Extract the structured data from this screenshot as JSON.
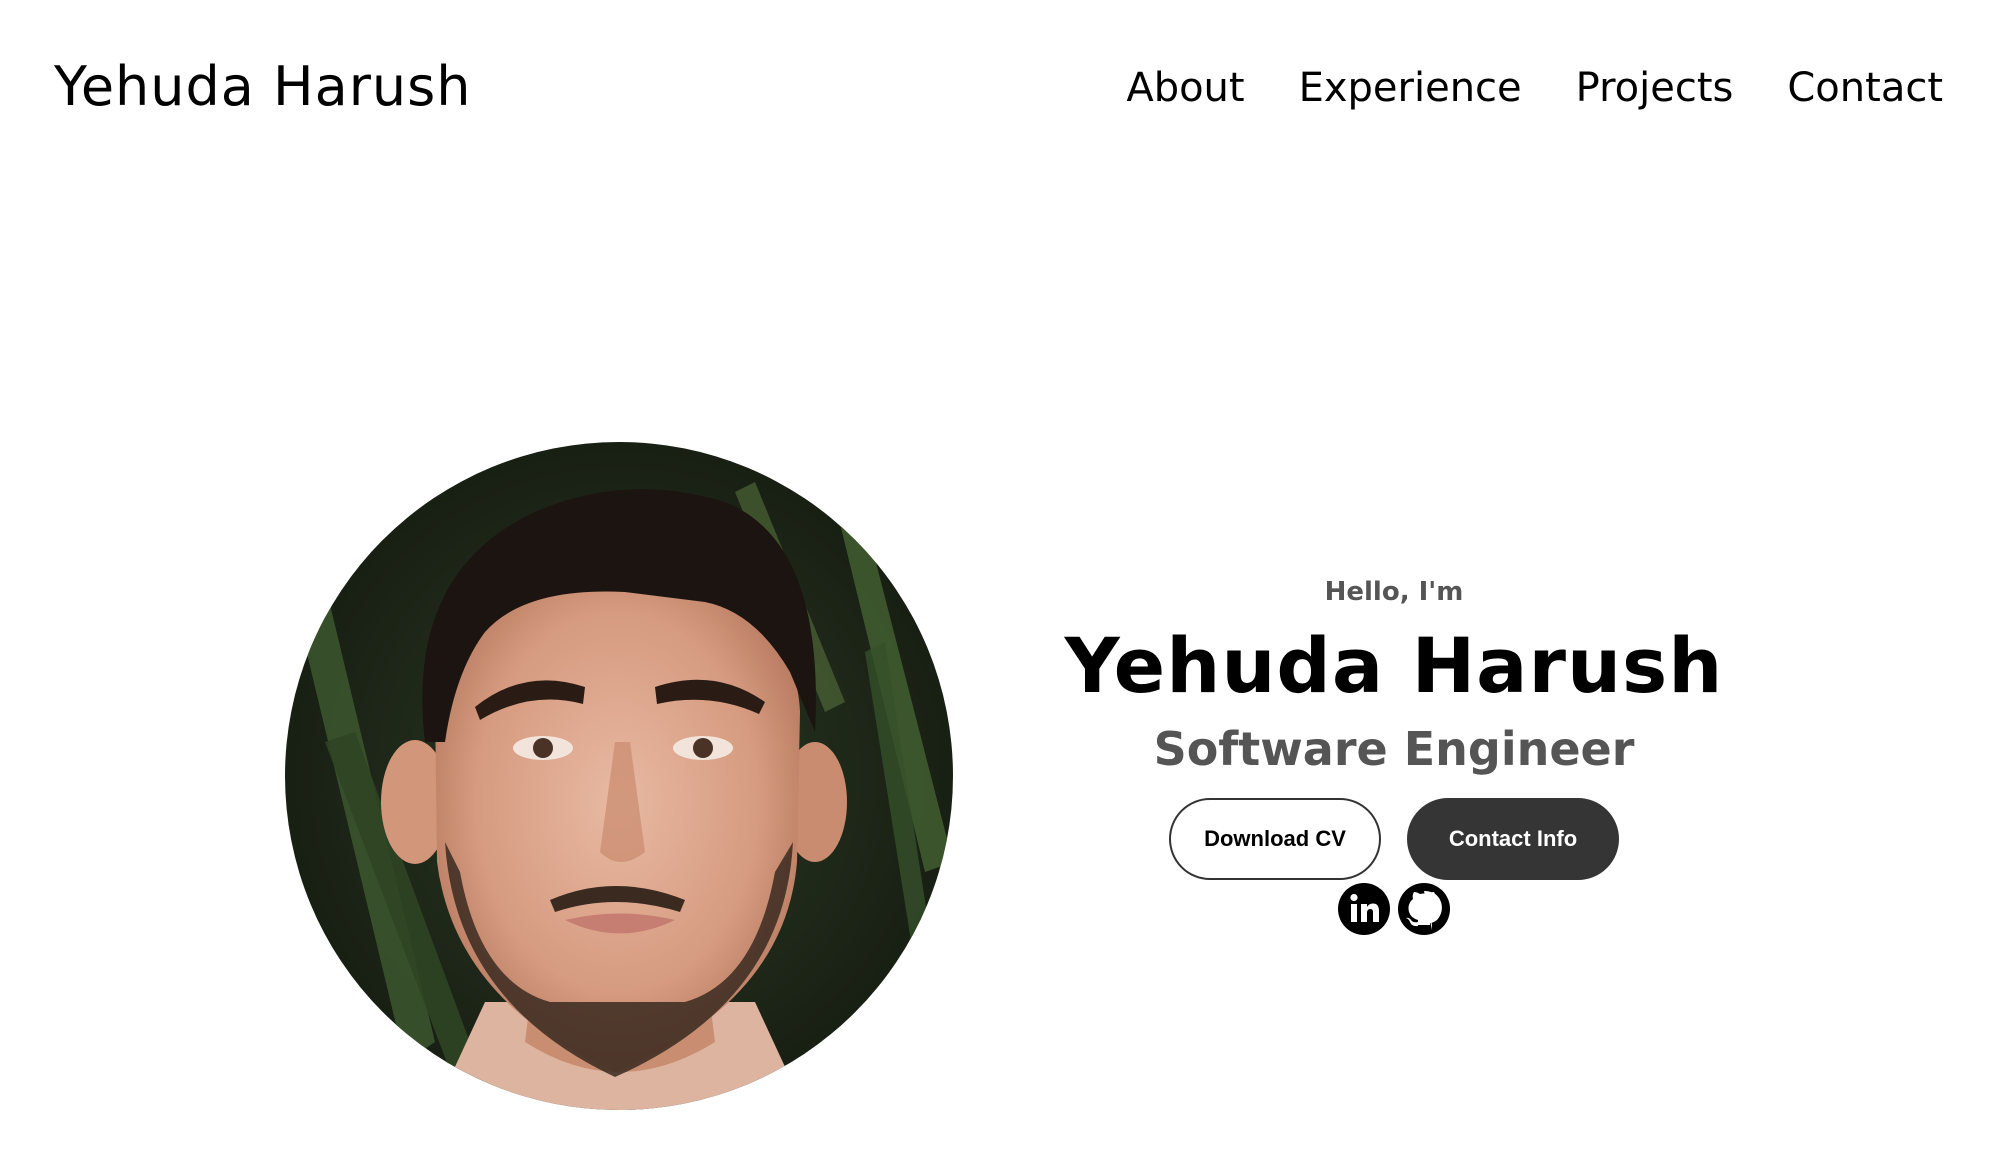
{
  "header": {
    "logo": "Yehuda Harush",
    "nav": [
      {
        "label": "About"
      },
      {
        "label": "Experience"
      },
      {
        "label": "Projects"
      },
      {
        "label": "Contact"
      }
    ]
  },
  "hero": {
    "greeting": "Hello, I'm",
    "name": "Yehuda Harush",
    "title": "Software Engineer",
    "buttons": {
      "download_cv": "Download CV",
      "contact_info": "Contact Info"
    },
    "social_icons": [
      "linkedin-icon",
      "github-icon"
    ]
  },
  "colors": {
    "text_primary": "#000000",
    "text_secondary": "#555555",
    "button_dark": "#353535",
    "background": "#ffffff"
  }
}
